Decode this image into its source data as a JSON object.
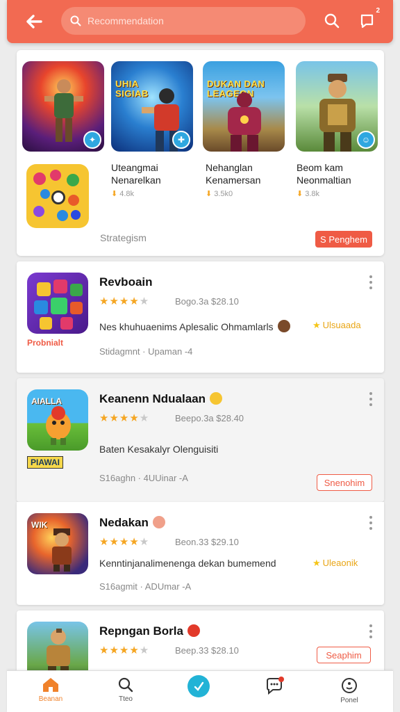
{
  "header": {
    "search_placeholder": "Recommendation",
    "notification_count": "2"
  },
  "featured": {
    "items": [
      {
        "title": "",
        "badge_icon": "twitter-icon"
      },
      {
        "title": "UHIA\nSIGIAB",
        "badge_icon": "puzzle-icon"
      },
      {
        "title": "DUKAN DAN\nLEAGEON",
        "badge_icon": ""
      },
      {
        "title": "",
        "badge_icon": "game-icon"
      }
    ],
    "apps": [
      {
        "name": "Uteangmai\nNenarelkan",
        "meta": "4.8k"
      },
      {
        "name": "Nehanglan\nKenamersan",
        "meta": "3.5k0"
      },
      {
        "name": "Beom kam\nNeonmaltian",
        "meta": "3.8k"
      }
    ],
    "footer_label": "Strategism",
    "footer_button": "S Penghem"
  },
  "list": [
    {
      "title": "Revboain",
      "rating": 4,
      "meta": "Bogo.3a  $28.10",
      "icon_label": "",
      "sub_logo": "Probnialt",
      "desc": "Nes khuhuaenims Aplesalic Ohmamlarls",
      "tagline": "Ulsuaada",
      "footer": "Stidagmnt · Upaman -4",
      "button": ""
    },
    {
      "title": "Keanenn Ndualaan",
      "rating": 4,
      "meta": "Beepo.3a  $28.40",
      "icon_label": "AIALLA",
      "sub_logo": "PIAWAI",
      "desc": "Baten Kesakalyr Olenguisiti",
      "tagline": "",
      "footer": "S16aghn · 4UUinar -A",
      "button": "Snenohim"
    },
    {
      "title": "Nedakan",
      "rating": 4,
      "meta": "Beon.33  $29.10",
      "icon_label": "WIK",
      "sub_logo": "",
      "desc": "Kenntinjanalimenenga dekan bumemend",
      "tagline": "Uleaonik",
      "footer": "S16agmit · ADUmar -A",
      "button": ""
    },
    {
      "title": "Repngan Borla",
      "rating": 4,
      "meta": "Beep.33  $28.10",
      "icon_label": "",
      "sub_logo": "",
      "desc": "",
      "tagline": "",
      "footer": "",
      "button": "Seaphim"
    }
  ],
  "nav": {
    "home": "Beanan",
    "search": "Tteo",
    "center": "",
    "chat": "",
    "profile": "Ponel"
  },
  "colors": {
    "accent": "#f26a52",
    "star": "#f5a623"
  }
}
